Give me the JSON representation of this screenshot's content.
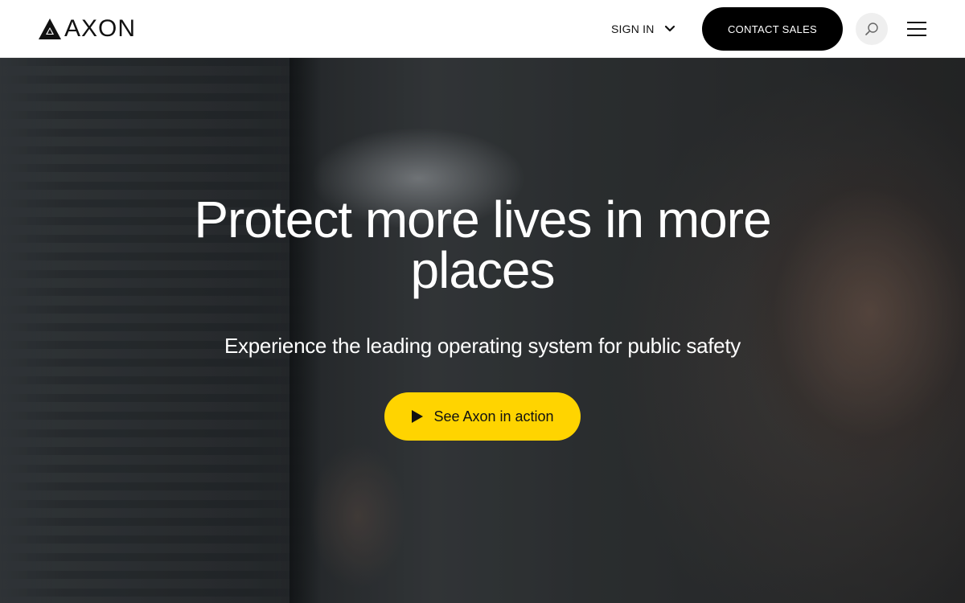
{
  "header": {
    "logo_text": "AXON",
    "sign_in_label": "SIGN IN",
    "contact_label": "CONTACT SALES",
    "search_icon": "search-icon",
    "menu_icon": "hamburger-menu-icon"
  },
  "hero": {
    "title": "Protect more lives in more places",
    "subtitle": "Experience the leading operating system for public safety",
    "cta_label": "See Axon in action",
    "cta_icon": "play-icon"
  },
  "colors": {
    "accent": "#ffd400",
    "header_bg": "#ffffff",
    "button_dark": "#000000",
    "text_light": "#ffffff"
  }
}
